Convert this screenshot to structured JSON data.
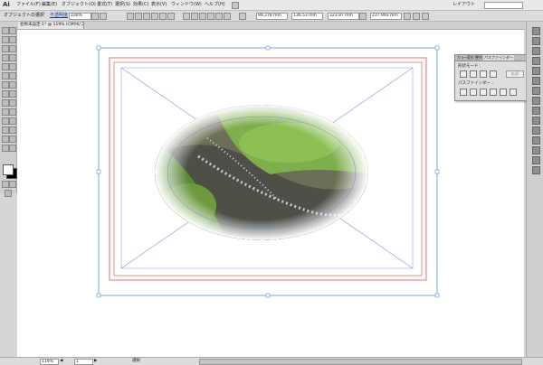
{
  "app": {
    "logo": "Ai"
  },
  "menu": {
    "items": [
      "ファイル(F)",
      "編集(E)",
      "オブジェクト(O)",
      "書式(T)",
      "選択(S)",
      "効果(C)",
      "表示(V)",
      "ウィンドウ(W)",
      "ヘルプ(H)"
    ],
    "workspace": "レイアウト"
  },
  "control": {
    "object_type": "オブジェクトの選択",
    "opacity_label": "不透明度",
    "opacity_value": "100%",
    "x_value": "99.278 mm",
    "y_value": "136.53 mm",
    "w_value": "323.97 mm",
    "h_value": "237.993 mm"
  },
  "document": {
    "tab_title": "名称未設定-1* @ 119% (CMYK/プレビュー)"
  },
  "pathfinder_panel": {
    "tabs": [
      "カラー",
      "変形",
      "整列",
      "パスファインダー"
    ],
    "shape_mode_label": "形状モード :",
    "expand_label": "拡張",
    "pathfinder_label": "パスファインダー :"
  },
  "status": {
    "zoom": "119%",
    "artboard": "1",
    "tool_name": "選択"
  }
}
